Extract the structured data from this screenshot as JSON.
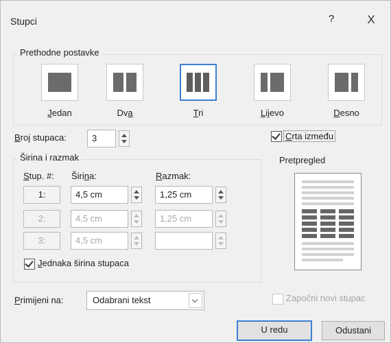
{
  "dialog": {
    "title": "Stupci",
    "help_label": "?",
    "close_label": "X"
  },
  "presets": {
    "group_label": "Prethodne postavke",
    "items": [
      {
        "label": "Jedan",
        "icon": "one-column-icon",
        "selected": false
      },
      {
        "label": "Dva",
        "icon": "two-columns-icon",
        "selected": false
      },
      {
        "label": "Tri",
        "icon": "three-columns-icon",
        "selected": true
      },
      {
        "label": "Lijevo",
        "icon": "left-column-icon",
        "selected": false
      },
      {
        "label": "Desno",
        "icon": "right-column-icon",
        "selected": false
      }
    ]
  },
  "column_count": {
    "label": "Broj stupaca:",
    "value": "3"
  },
  "line_between": {
    "label": "Crta između",
    "checked": true
  },
  "width_spacing": {
    "group_label": "Širina i razmak",
    "headers": {
      "col": "Stup. #:",
      "width": "Širina:",
      "spacing": "Razmak:"
    },
    "rows": [
      {
        "col": "1:",
        "width": "4,5 cm",
        "spacing": "1,25 cm",
        "enabled": true
      },
      {
        "col": "2:",
        "width": "4,5 cm",
        "spacing": "1,25 cm",
        "enabled": false
      },
      {
        "col": "3:",
        "width": "4,5 cm",
        "spacing": "",
        "enabled": false
      }
    ],
    "equal_width": {
      "label": "Jednaka širina stupaca",
      "checked": true
    }
  },
  "preview": {
    "label": "Pretpregled"
  },
  "apply_to": {
    "label": "Primijeni na:",
    "value": "Odabrani tekst"
  },
  "new_column": {
    "label": "Započni novi stupac",
    "checked": false
  },
  "buttons": {
    "ok": "U redu",
    "cancel": "Odustani"
  },
  "colors": {
    "accent": "#3c7fd6",
    "background": "#f0f0f0",
    "disabled_text": "#a6a6a6"
  }
}
